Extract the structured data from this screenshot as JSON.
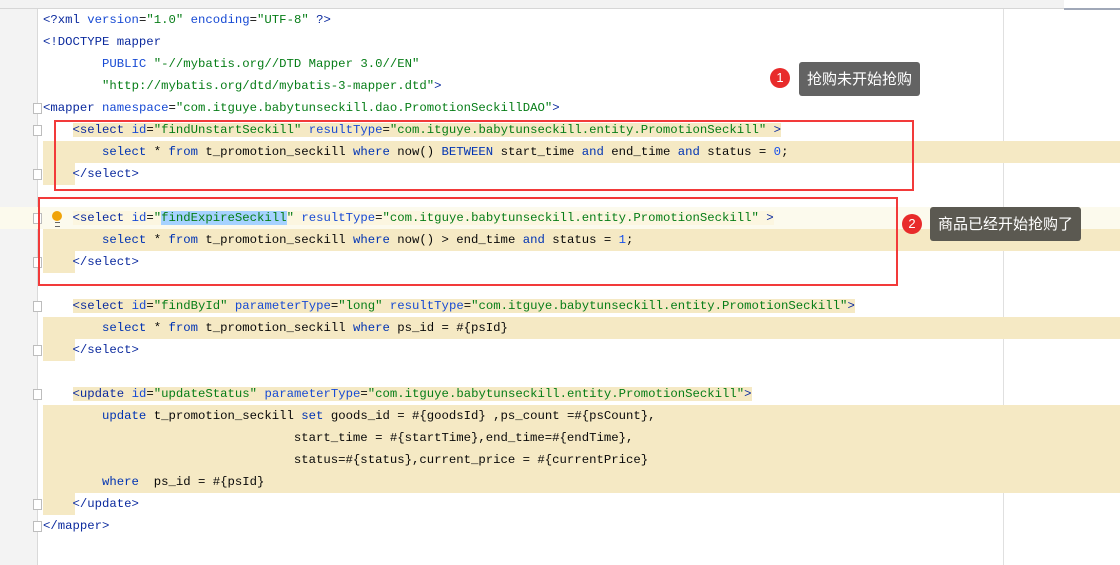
{
  "editor": {
    "lines": [
      {
        "kind": "plain",
        "tokens": [
          [
            "<?xml ",
            "t-tag"
          ],
          [
            "version",
            "t-attr"
          ],
          [
            "=",
            "t-pl"
          ],
          [
            "\"1.0\" ",
            "t-str"
          ],
          [
            "encoding",
            "t-attr"
          ],
          [
            "=",
            "t-pl"
          ],
          [
            "\"UTF-8\" ",
            "t-str"
          ],
          [
            "?>",
            "t-tag"
          ]
        ]
      },
      {
        "kind": "plain",
        "tokens": [
          [
            "<!DOCTYPE mapper",
            "t-tag"
          ]
        ]
      },
      {
        "kind": "plain",
        "tokens": [
          [
            "        PUBLIC ",
            "t-attr"
          ],
          [
            "\"-//mybatis.org//DTD Mapper 3.0//EN\"",
            "t-str"
          ]
        ]
      },
      {
        "kind": "plain",
        "tokens": [
          [
            "        ",
            "t-pl"
          ],
          [
            "\"http://mybatis.org/dtd/mybatis-3-mapper.dtd\"",
            "t-str"
          ],
          [
            ">",
            "t-tag"
          ]
        ]
      },
      {
        "kind": "plain",
        "fold": true,
        "tokens": [
          [
            "<mapper ",
            "t-tag"
          ],
          [
            "namespace",
            "t-attr"
          ],
          [
            "=",
            "t-pl"
          ],
          [
            "\"com.itguye.babytunseckill.dao.PromotionSeckillDAO\"",
            "t-str"
          ],
          [
            ">",
            "t-tag"
          ]
        ]
      },
      {
        "kind": "open",
        "fold": true,
        "tokens": [
          [
            "<select ",
            "t-tag"
          ],
          [
            "id",
            "t-attr"
          ],
          [
            "=",
            "t-pl"
          ],
          [
            "\"findUnstartSeckill\" ",
            "t-str"
          ],
          [
            "resultType",
            "t-attr"
          ],
          [
            "=",
            "t-pl"
          ],
          [
            "\"com.itguye.babytunseckill.entity.PromotionSeckill\" ",
            "t-str"
          ],
          [
            ">",
            "t-tag"
          ]
        ]
      },
      {
        "kind": "body",
        "tokens": [
          [
            "        select ",
            "t-kw"
          ],
          [
            "* ",
            "t-pl"
          ],
          [
            "from ",
            "t-kw"
          ],
          [
            "t_promotion_seckill ",
            "t-pl"
          ],
          [
            "where ",
            "t-kw"
          ],
          [
            "now() ",
            "t-pl"
          ],
          [
            "BETWEEN ",
            "t-kw"
          ],
          [
            "start_time ",
            "t-pl"
          ],
          [
            "and ",
            "t-kw"
          ],
          [
            "end_time ",
            "t-pl"
          ],
          [
            "and ",
            "t-kw"
          ],
          [
            "status = ",
            "t-pl"
          ],
          [
            "0",
            "t-num"
          ],
          [
            ";",
            "t-pl"
          ]
        ]
      },
      {
        "kind": "close",
        "fold": true,
        "tokens": [
          [
            "    </select>",
            "t-tag"
          ]
        ]
      },
      {
        "kind": "blank",
        "tokens": []
      },
      {
        "kind": "open",
        "caret": true,
        "fold": true,
        "bulb": true,
        "tokens": [
          [
            "<select ",
            "t-tag"
          ],
          [
            "id",
            "t-attr"
          ],
          [
            "=",
            "t-pl"
          ],
          [
            "\"",
            "t-str"
          ],
          [
            "findExpireSeckill",
            "sel t-str"
          ],
          [
            "\" ",
            "t-str"
          ],
          [
            "resultType",
            "t-attr"
          ],
          [
            "=",
            "t-pl"
          ],
          [
            "\"com.itguye.babytunseckill.entity.PromotionSeckill\" ",
            "t-str"
          ],
          [
            ">",
            "t-tag"
          ]
        ]
      },
      {
        "kind": "body",
        "tokens": [
          [
            "        select ",
            "t-kw"
          ],
          [
            "* ",
            "t-pl"
          ],
          [
            "from ",
            "t-kw"
          ],
          [
            "t_promotion_seckill ",
            "t-pl"
          ],
          [
            "where ",
            "t-kw"
          ],
          [
            "now() > end_time ",
            "t-pl"
          ],
          [
            "and ",
            "t-kw"
          ],
          [
            "status = ",
            "t-pl"
          ],
          [
            "1",
            "t-num"
          ],
          [
            ";",
            "t-pl"
          ]
        ]
      },
      {
        "kind": "close",
        "fold": true,
        "tokens": [
          [
            "    </select>",
            "t-tag"
          ]
        ]
      },
      {
        "kind": "blank",
        "tokens": []
      },
      {
        "kind": "open",
        "fold": true,
        "tokens": [
          [
            "<select ",
            "t-tag"
          ],
          [
            "id",
            "t-attr"
          ],
          [
            "=",
            "t-pl"
          ],
          [
            "\"findById\" ",
            "t-str"
          ],
          [
            "parameterType",
            "t-attr"
          ],
          [
            "=",
            "t-pl"
          ],
          [
            "\"long\" ",
            "t-str"
          ],
          [
            "resultType",
            "t-attr"
          ],
          [
            "=",
            "t-pl"
          ],
          [
            "\"com.itguye.babytunseckill.entity.PromotionSeckill\"",
            "t-str"
          ],
          [
            ">",
            "t-tag"
          ]
        ]
      },
      {
        "kind": "body",
        "tokens": [
          [
            "        select ",
            "t-kw"
          ],
          [
            "* ",
            "t-pl"
          ],
          [
            "from ",
            "t-kw"
          ],
          [
            "t_promotion_seckill ",
            "t-pl"
          ],
          [
            "where ",
            "t-kw"
          ],
          [
            "ps_id = #{psId}",
            "t-pl"
          ]
        ]
      },
      {
        "kind": "close",
        "fold": true,
        "tokens": [
          [
            "    </select>",
            "t-tag"
          ]
        ]
      },
      {
        "kind": "blank",
        "tokens": []
      },
      {
        "kind": "open",
        "fold": true,
        "tokens": [
          [
            "<update ",
            "t-tag"
          ],
          [
            "id",
            "t-attr"
          ],
          [
            "=",
            "t-pl"
          ],
          [
            "\"updateStatus\" ",
            "t-str"
          ],
          [
            "parameterType",
            "t-attr"
          ],
          [
            "=",
            "t-pl"
          ],
          [
            "\"com.itguye.babytunseckill.entity.PromotionSeckill\"",
            "t-str"
          ],
          [
            ">",
            "t-tag"
          ]
        ]
      },
      {
        "kind": "body",
        "tokens": [
          [
            "        update ",
            "t-kw"
          ],
          [
            "t_promotion_seckill ",
            "t-pl"
          ],
          [
            "set ",
            "t-kw"
          ],
          [
            "goods_id = #{goodsId} ,ps_count =#{psCount},",
            "t-pl"
          ]
        ]
      },
      {
        "kind": "body",
        "tokens": [
          [
            "                                  start_time = #{startTime},end_time=#{endTime},",
            "t-pl"
          ]
        ]
      },
      {
        "kind": "body",
        "tokens": [
          [
            "                                  status=#{status},current_price = #{currentPrice}",
            "t-pl"
          ]
        ]
      },
      {
        "kind": "body",
        "tokens": [
          [
            "        where  ",
            "t-kw"
          ],
          [
            "ps_id = #{psId}",
            "t-pl"
          ]
        ]
      },
      {
        "kind": "close",
        "fold": true,
        "tokens": [
          [
            "    </update>",
            "t-tag"
          ]
        ]
      },
      {
        "kind": "plain",
        "fold": true,
        "tokens": [
          [
            "</mapper>",
            "t-tag"
          ]
        ]
      }
    ]
  },
  "annotations": [
    {
      "number": "1",
      "text": "抢购未开始抢购"
    },
    {
      "number": "2",
      "text": "商品已经开始抢购了"
    }
  ],
  "colors": {
    "highlight": "#f5e9c4",
    "selection": "#a6d2ff",
    "annotation_box": "#f23a3a",
    "badge": "#e82b2b"
  }
}
